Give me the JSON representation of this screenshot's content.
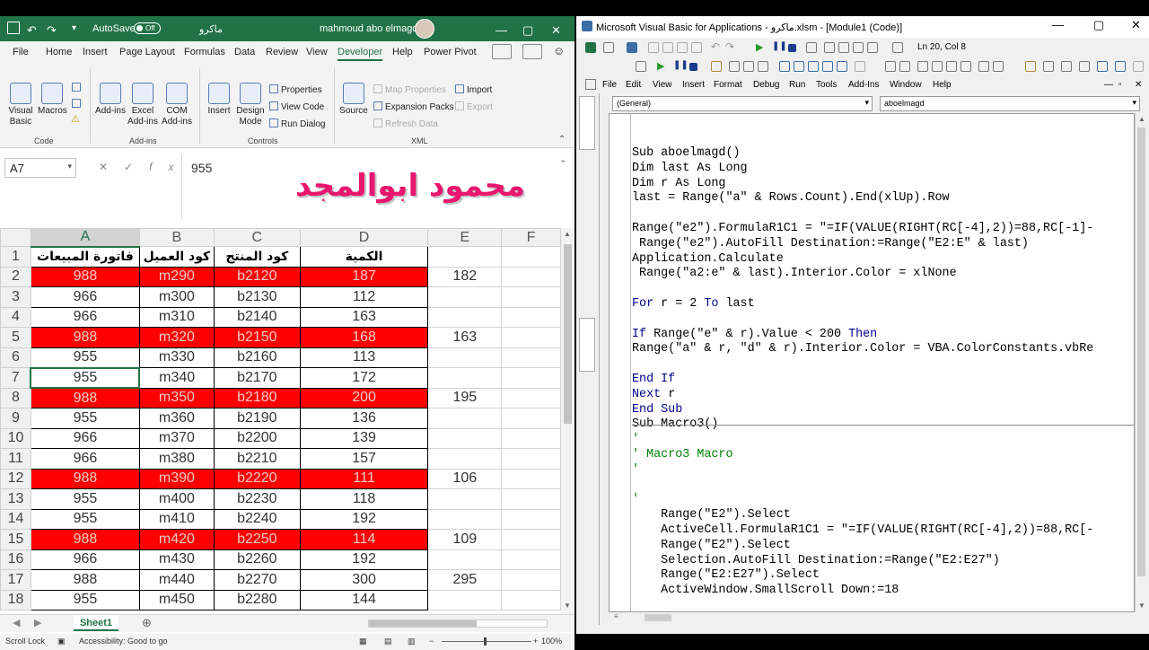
{
  "excel": {
    "title_bar": {
      "autosave": "AutoSave",
      "autosave_state": "Off",
      "file_name": "ماكرو",
      "user_name": "mahmoud abo elmagd"
    },
    "tabs": [
      "File",
      "Home",
      "Insert",
      "Page Layout",
      "Formulas",
      "Data",
      "Review",
      "View",
      "Developer",
      "Help",
      "Power Pivot"
    ],
    "active_tab": "Developer",
    "ribbon": {
      "code_group": "Code",
      "visual_basic": "Visual Basic",
      "macros": "Macros",
      "addins_group": "Add-ins",
      "add_ins": "Add-ins",
      "excel_add_ins": "Excel Add-ins",
      "com_add_ins": "COM Add-ins",
      "controls_group": "Controls",
      "insert": "Insert",
      "design_mode": "Design Mode",
      "properties": "Properties",
      "view_code": "View Code",
      "run_dialog": "Run Dialog",
      "xml_group": "XML",
      "source": "Source",
      "map_properties": "Map Properties",
      "expansion_packs": "Expansion Packs",
      "refresh_data": "Refresh Data",
      "import": "Import",
      "export": "Export"
    },
    "name_box": "A7",
    "formula_value": "955",
    "banner_text": "محمود ابوالمجد",
    "columns": [
      "A",
      "B",
      "C",
      "D",
      "E",
      "F"
    ],
    "header_row": [
      "فاتورة المبيعات",
      "كود العميل",
      "كود المنتج",
      "الكمية"
    ],
    "rows": [
      {
        "n": "2",
        "a": "988",
        "b": "m290",
        "c": "b2120",
        "d": "187",
        "e": "182",
        "red": true
      },
      {
        "n": "3",
        "a": "966",
        "b": "m300",
        "c": "b2130",
        "d": "112",
        "e": "",
        "red": false
      },
      {
        "n": "4",
        "a": "966",
        "b": "m310",
        "c": "b2140",
        "d": "163",
        "e": "",
        "red": false
      },
      {
        "n": "5",
        "a": "988",
        "b": "m320",
        "c": "b2150",
        "d": "168",
        "e": "163",
        "red": true
      },
      {
        "n": "6",
        "a": "955",
        "b": "m330",
        "c": "b2160",
        "d": "113",
        "e": "",
        "red": false
      },
      {
        "n": "7",
        "a": "955",
        "b": "m340",
        "c": "b2170",
        "d": "172",
        "e": "",
        "red": false
      },
      {
        "n": "8",
        "a": "988",
        "b": "m350",
        "c": "b2180",
        "d": "200",
        "e": "195",
        "red": true
      },
      {
        "n": "9",
        "a": "955",
        "b": "m360",
        "c": "b2190",
        "d": "136",
        "e": "",
        "red": false
      },
      {
        "n": "10",
        "a": "966",
        "b": "m370",
        "c": "b2200",
        "d": "139",
        "e": "",
        "red": false
      },
      {
        "n": "11",
        "a": "966",
        "b": "m380",
        "c": "b2210",
        "d": "157",
        "e": "",
        "red": false
      },
      {
        "n": "12",
        "a": "988",
        "b": "m390",
        "c": "b2220",
        "d": "111",
        "e": "106",
        "red": true
      },
      {
        "n": "13",
        "a": "955",
        "b": "m400",
        "c": "b2230",
        "d": "118",
        "e": "",
        "red": false
      },
      {
        "n": "14",
        "a": "955",
        "b": "m410",
        "c": "b2240",
        "d": "192",
        "e": "",
        "red": false
      },
      {
        "n": "15",
        "a": "988",
        "b": "m420",
        "c": "b2250",
        "d": "114",
        "e": "109",
        "red": true
      },
      {
        "n": "16",
        "a": "966",
        "b": "m430",
        "c": "b2260",
        "d": "192",
        "e": "",
        "red": false
      },
      {
        "n": "17",
        "a": "988",
        "b": "m440",
        "c": "b2270",
        "d": "300",
        "e": "295",
        "red": false
      },
      {
        "n": "18",
        "a": "955",
        "b": "m450",
        "c": "b2280",
        "d": "144",
        "e": "",
        "red": false
      }
    ],
    "sheet_tab": "Sheet1",
    "status": {
      "scroll_lock": "Scroll Lock",
      "accessibility": "Accessibility: Good to go",
      "zoom": "100%"
    }
  },
  "vbe": {
    "title": "Microsoft Visual Basic for Applications - ماكرو.xlsm - [Module1 (Code)]",
    "position": "Ln 20, Col 8",
    "menus": [
      "File",
      "Edit",
      "View",
      "Insert",
      "Format",
      "Debug",
      "Run",
      "Tools",
      "Add-Ins",
      "Window",
      "Help"
    ],
    "object_combo": "(General)",
    "proc_combo": "aboelmagd",
    "code_lines": [
      [
        [
          "",
          "Sub aboelmagd()"
        ]
      ],
      [
        [
          "",
          "Dim last As Long"
        ]
      ],
      [
        [
          "",
          "Dim r As Long"
        ]
      ],
      [
        [
          "",
          "last = Range(\"a\" & Rows.Count).End(xlUp).Row"
        ]
      ],
      [
        [
          "",
          ""
        ]
      ],
      [
        [
          "",
          "Range(\"e2\").FormulaR1C1 = \"=IF(VALUE(RIGHT(RC[-4],2))=88,RC[-1]-"
        ]
      ],
      [
        [
          "",
          " Range(\"e2\").AutoFill Destination:=Range(\"E2:E\" & last)"
        ]
      ],
      [
        [
          "",
          "Application.Calculate"
        ]
      ],
      [
        [
          "",
          " Range(\"a2:e\" & last).Interior.Color = xlNone"
        ]
      ],
      [
        [
          "",
          ""
        ]
      ],
      [
        [
          "kw",
          "For"
        ],
        [
          "",
          " r = 2 "
        ],
        [
          "kw",
          "To"
        ],
        [
          "",
          " last"
        ]
      ],
      [
        [
          "",
          ""
        ]
      ],
      [
        [
          "kw",
          "If"
        ],
        [
          "",
          " Range(\"e\" & r).Value < 200 "
        ],
        [
          "kw",
          "Then"
        ]
      ],
      [
        [
          "",
          "Range(\"a\" & r, \"d\" & r).Interior.Color = VBA.ColorConstants.vbRe"
        ]
      ],
      [
        [
          "",
          ""
        ]
      ],
      [
        [
          "kw",
          "End If"
        ]
      ],
      [
        [
          "kw",
          "Next"
        ],
        [
          "",
          " r"
        ]
      ],
      [
        [
          "kw",
          "End Sub"
        ]
      ],
      [
        [
          "",
          "Sub Macro3()"
        ]
      ],
      [
        [
          "cm",
          "'"
        ]
      ],
      [
        [
          "cm",
          "' Macro3 Macro"
        ]
      ],
      [
        [
          "cm",
          "'"
        ]
      ],
      [
        [
          "",
          ""
        ]
      ],
      [
        [
          "cm",
          "'"
        ]
      ],
      [
        [
          "",
          "    Range(\"E2\").Select"
        ]
      ],
      [
        [
          "",
          "    ActiveCell.FormulaR1C1 = \"=IF(VALUE(RIGHT(RC[-4],2))=88,RC[-"
        ]
      ],
      [
        [
          "",
          "    Range(\"E2\").Select"
        ]
      ],
      [
        [
          "",
          "    Selection.AutoFill Destination:=Range(\"E2:E27\")"
        ]
      ],
      [
        [
          "",
          "    Range(\"E2:E27\").Select"
        ]
      ],
      [
        [
          "",
          "    ActiveWindow.SmallScroll Down:=18"
        ]
      ]
    ]
  },
  "colors": {
    "excel_green": "#217346",
    "highlight_red": "#ff0000",
    "vba_keyword": "#00008b",
    "vba_comment": "#008000"
  }
}
